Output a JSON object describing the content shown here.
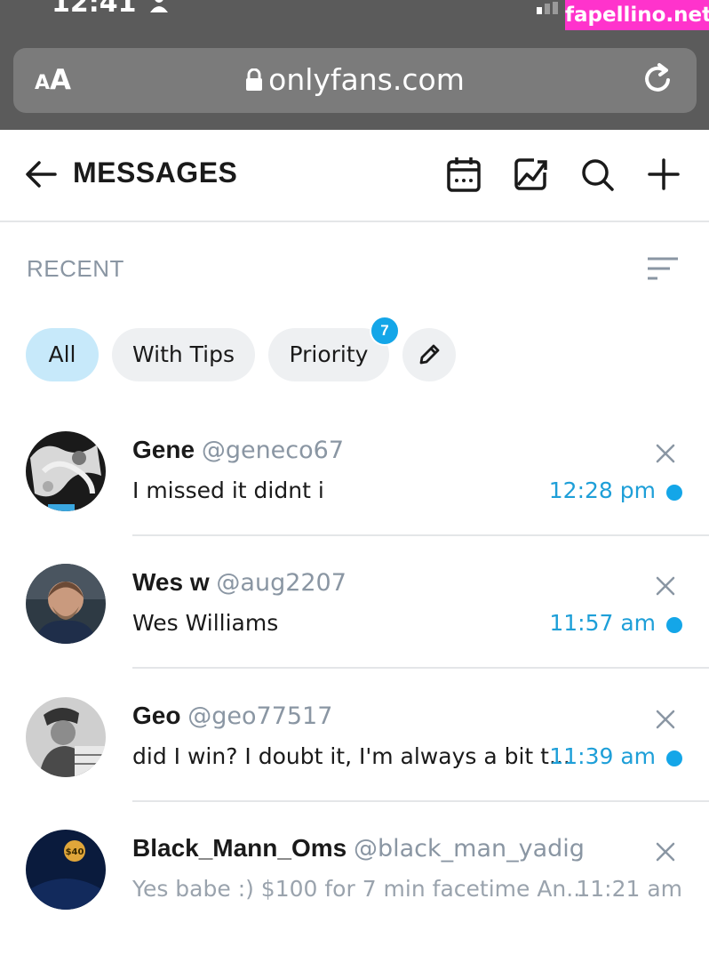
{
  "status": {
    "time": "12:41"
  },
  "watermark": "fapellino.net",
  "browser": {
    "aa_small": "A",
    "aa_big": "A",
    "url": "onlyfans.com"
  },
  "header": {
    "title": "MESSAGES"
  },
  "section": {
    "title": "RECENT"
  },
  "filters": {
    "all": "All",
    "with_tips": "With Tips",
    "priority": "Priority",
    "priority_count": "7"
  },
  "conversations": [
    {
      "name": "Gene",
      "handle": "@geneco67",
      "message": "I missed it didnt i",
      "time": "12:28 pm",
      "unread": true
    },
    {
      "name": "Wes w",
      "handle": "@aug2207",
      "message": "Wes Williams",
      "time": "11:57 am",
      "unread": true
    },
    {
      "name": "Geo",
      "handle": "@geo77517",
      "message": "did I win? I doubt it, I'm always a bit t...",
      "time": "11:39 am",
      "unread": true
    },
    {
      "name": "Black_Mann_Oms",
      "handle": "@black_man_yadig",
      "message": "Yes babe :) $100 for 7 min facetime An...",
      "time": "11:21 am",
      "avatar_text": "$40"
    }
  ],
  "colors": {
    "accent": "#14a6e8",
    "muted": "#8a96a3",
    "chip_active": "#c7e9fa",
    "browser_bar": "#5b5b5b"
  }
}
